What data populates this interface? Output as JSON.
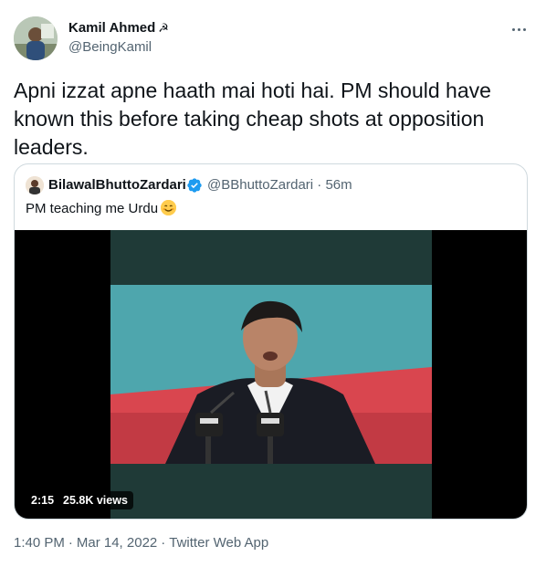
{
  "author": {
    "name": "Kamil Ahmed",
    "handle": "@BeingKamil",
    "flag_glyph": "☭"
  },
  "tweet_text": "Apni izzat apne haath mai hoti hai. PM should have known this before taking cheap shots at opposition leaders.",
  "quoted": {
    "name": "BilawalBhuttoZardari",
    "handle": "@BBhuttoZardari",
    "time": "56m",
    "text": "PM teaching me Urdu",
    "emoji": "smiling-face-emoji",
    "verified_color": "#1d9bf0"
  },
  "video": {
    "duration": "2:15",
    "views": "25.8K views"
  },
  "meta": {
    "time": "1:40 PM",
    "date": "Mar 14, 2022",
    "source": "Twitter Web App"
  },
  "colors": {
    "text": "#0f1419",
    "secondary": "#536471",
    "border": "#cfd9de"
  }
}
